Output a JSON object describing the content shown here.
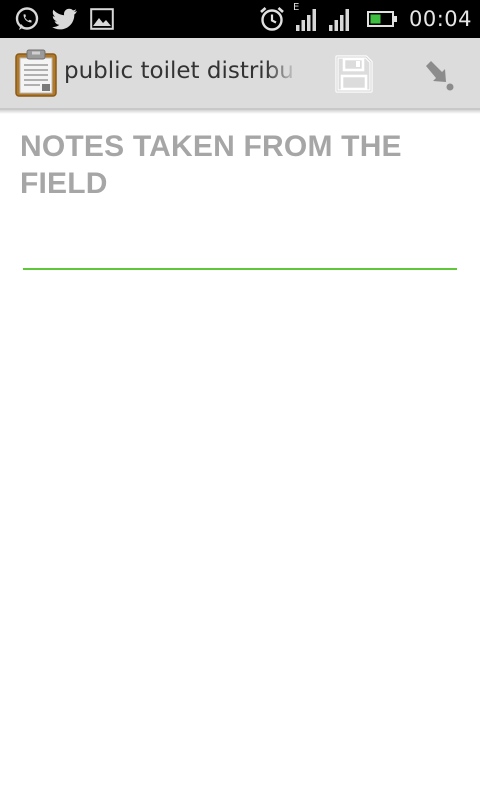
{
  "status_bar": {
    "time": "00:04",
    "network_type": "E",
    "icons": [
      "whatsapp-icon",
      "twitter-icon",
      "image-icon",
      "alarm-icon",
      "signal-icon",
      "signal-icon",
      "battery-icon"
    ],
    "battery_color": "#3fbf3f"
  },
  "action_bar": {
    "title": "public toilet distribu",
    "app_icon": "clipboard-icon",
    "actions": [
      {
        "name": "save",
        "icon": "floppy-disk-icon"
      },
      {
        "name": "import",
        "icon": "arrow-down-right-icon"
      }
    ],
    "background": "#dcdcdc"
  },
  "form": {
    "label": "NOTES TAKEN FROM THE FIELD",
    "notes_value": "",
    "underline_color": "#5ec73a"
  }
}
